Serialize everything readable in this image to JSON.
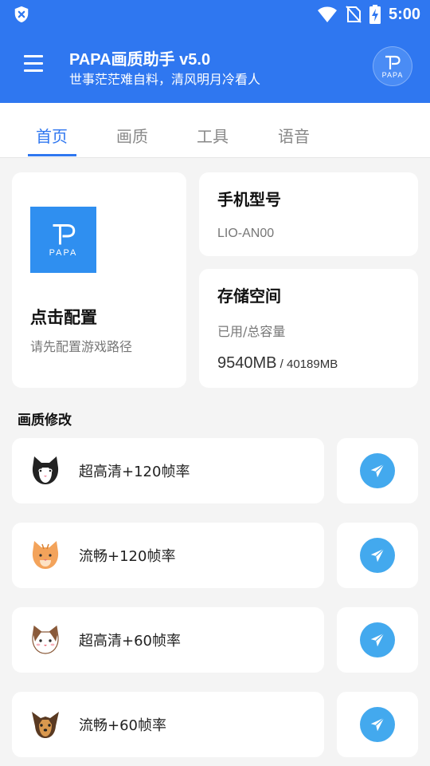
{
  "status_bar": {
    "time": "5:00",
    "icons": [
      "shield-icon",
      "wifi-icon",
      "no-sim-icon",
      "battery-charging-icon"
    ]
  },
  "header": {
    "title": "PAPA画质助手 v5.0",
    "subtitle": "世事茫茫难自料，清风明月冷看人",
    "avatar_text": "PAPA",
    "background_color": "#2f77f0"
  },
  "tabs": [
    {
      "label": "首页",
      "active": true
    },
    {
      "label": "画质",
      "active": false
    },
    {
      "label": "工具",
      "active": false
    },
    {
      "label": "语音",
      "active": false
    }
  ],
  "config_card": {
    "logo_text": "PAPA",
    "title": "点击配置",
    "subtitle": "请先配置游戏路径"
  },
  "device": {
    "model_title": "手机型号",
    "model_value": "LIO-AN00",
    "storage_title": "存储空间",
    "storage_label": "已用/总容量",
    "storage_used": "9540MB",
    "storage_separator": " / ",
    "storage_total": "40189MB"
  },
  "quality_section": {
    "title": "画质修改",
    "presets": [
      {
        "label": "超高清+120帧率",
        "icon": "black-white-cat-icon"
      },
      {
        "label": "流畅+120帧率",
        "icon": "orange-cat-icon"
      },
      {
        "label": "超高清+60帧率",
        "icon": "calico-cat-icon"
      },
      {
        "label": "流畅+60帧率",
        "icon": "yorkie-dog-icon"
      }
    ],
    "action_icon": "send-icon",
    "action_color": "#43a9ee"
  }
}
